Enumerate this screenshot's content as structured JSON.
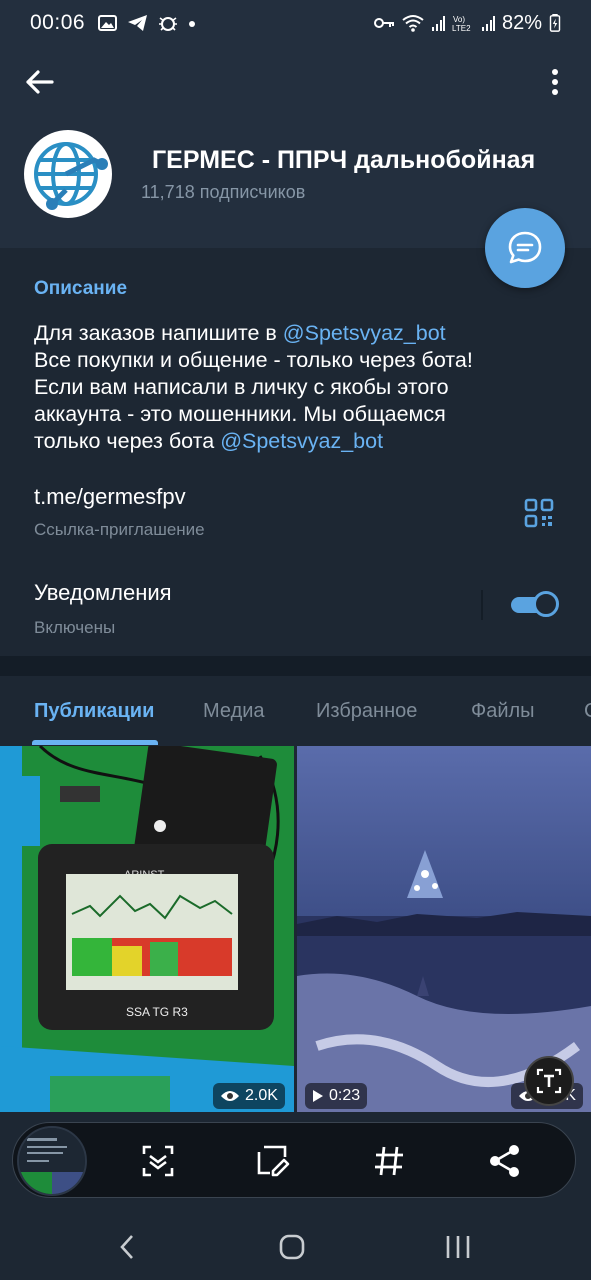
{
  "status_bar": {
    "time": "00:06",
    "battery": "82%",
    "left_icons": [
      "gallery-icon",
      "telegram-icon",
      "bug-icon",
      "dot-icon"
    ],
    "right_icons": [
      "key-icon",
      "wifi-icon",
      "signal-icon",
      "volte-icon",
      "signal-icon",
      "battery-icon"
    ],
    "volte_label": "Vo)\nLTE2"
  },
  "header": {
    "title": "ГЕРМЕС - ППРЧ дальнобойная",
    "subscribers": "11,718 подписчиков"
  },
  "info": {
    "description_label": "Описание",
    "description_lines": [
      {
        "text": "Для заказов напишите в ",
        "link": "@Spetsvyaz_bot"
      },
      {
        "text": "Все покупки и общение - только через бота!",
        "link": ""
      },
      {
        "text": "Если вам написали в личку с якобы этого",
        "link": ""
      },
      {
        "text": "аккаунта - это мошенники. Мы общаемся",
        "link": ""
      },
      {
        "text": "только через бота ",
        "link": "@Spetsvyaz_bot"
      }
    ],
    "invite_link": "t.me/germesfpv",
    "invite_label": "Ссылка-приглашение",
    "notifications_label": "Уведомления",
    "notifications_status": "Включены",
    "notifications_enabled": true
  },
  "tabs": [
    "Публикации",
    "Медиа",
    "Избранное",
    "Файлы",
    "С"
  ],
  "active_tab": "Публикации",
  "media": [
    {
      "type": "photo",
      "views": "2.0K",
      "device_brand": "ARINST",
      "device_model": "SSA TG R3"
    },
    {
      "type": "video",
      "duration": "0:23",
      "views": "2.0K"
    }
  ],
  "toolbar": {
    "buttons": [
      "scan-icon",
      "edit-screenshot-icon",
      "hashtag-icon",
      "share-icon"
    ]
  },
  "colors": {
    "background": "#1d2733",
    "header": "#232f3e",
    "accent": "#6ab3f3",
    "fab": "#5aa3e0",
    "secondary_text": "#7f8c99"
  }
}
